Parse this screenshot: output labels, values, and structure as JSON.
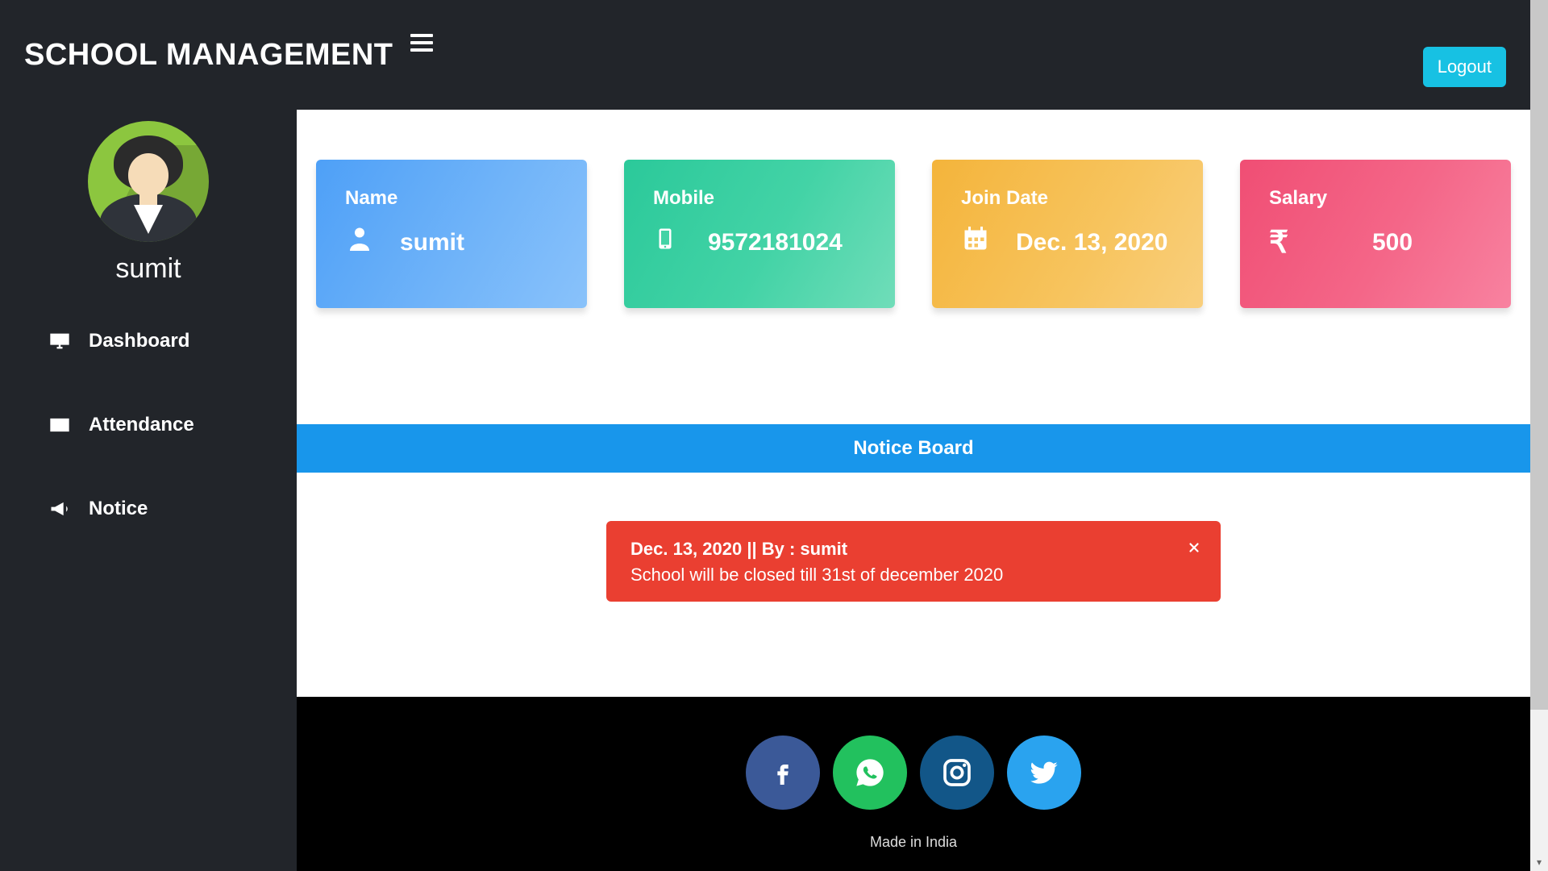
{
  "header": {
    "brand": "SCHOOL MANAGEMENT",
    "logout_label": "Logout"
  },
  "sidebar": {
    "username": "sumit",
    "items": [
      {
        "label": "Dashboard"
      },
      {
        "label": "Attendance"
      },
      {
        "label": "Notice"
      }
    ]
  },
  "cards": [
    {
      "title": "Name",
      "value": "sumit"
    },
    {
      "title": "Mobile",
      "value": "9572181024"
    },
    {
      "title": "Join Date",
      "value": "Dec. 13, 2020"
    },
    {
      "title": "Salary",
      "value": "500"
    }
  ],
  "notice_board": {
    "header": "Notice Board",
    "items": [
      {
        "meta": "Dec. 13, 2020 || By : sumit",
        "body": "School will be closed till 31st of december 2020"
      }
    ]
  },
  "footer": {
    "credit": "Made in India"
  }
}
